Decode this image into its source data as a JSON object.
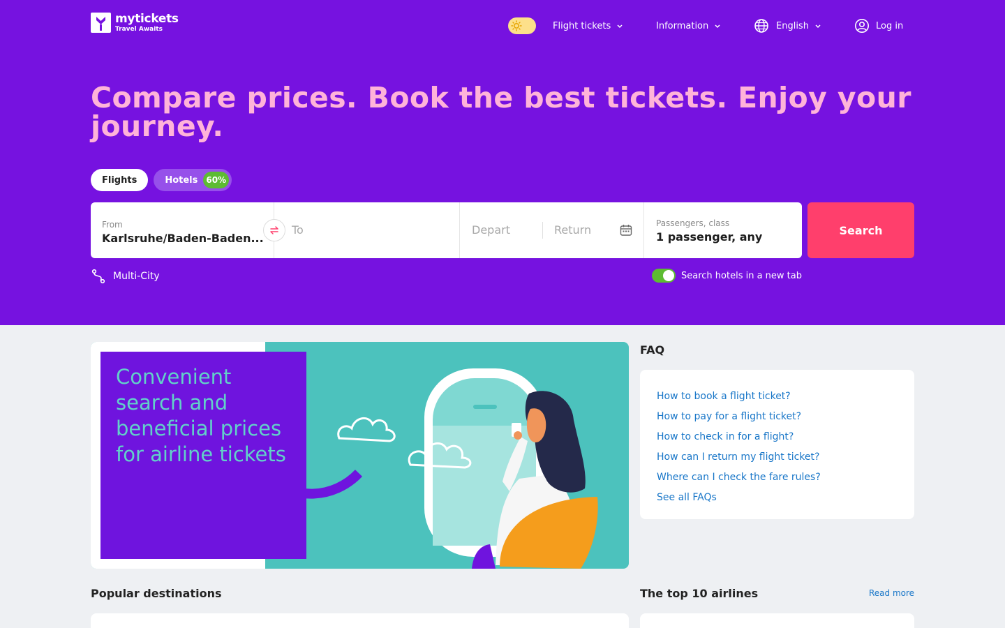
{
  "header": {
    "logo_name": "mytickets",
    "logo_tagline": "Travel Awaits",
    "nav": {
      "flight_tickets": "Flight tickets",
      "information": "Information",
      "language": "English",
      "login": "Log in"
    }
  },
  "hero": {
    "headline": "Compare prices. Book the best tickets. Enjoy your journey.",
    "tabs": {
      "flights": "Flights",
      "hotels": "Hotels",
      "hotels_badge": "60%"
    },
    "search": {
      "from_label": "From",
      "from_value": "Karlsruhe/Baden-Baden...",
      "to_placeholder": "To",
      "depart_placeholder": "Depart",
      "return_placeholder": "Return",
      "passengers_label": "Passengers, class",
      "passengers_value": "1 passenger, any",
      "button": "Search"
    },
    "multi_city": "Multi-City",
    "hotels_new_tab": "Search hotels in a new tab",
    "hotels_new_tab_enabled": true
  },
  "promo": {
    "text": "Convenient search and beneficial prices for airline tickets"
  },
  "faq": {
    "title": "FAQ",
    "links": [
      "How to book a flight ticket?",
      "How to pay for a flight ticket?",
      "How to check in for a flight?",
      "How can I return my flight ticket?",
      "Where can I check the fare rules?",
      "See all FAQs"
    ]
  },
  "sections": {
    "popular_destinations": "Popular destinations",
    "top_airlines": "The top 10 airlines",
    "read_more": "Read more"
  },
  "colors": {
    "hero_bg": "#7612e0",
    "headline": "#ffb3d9",
    "search_button": "#ff3f6c",
    "badge": "#5dbc32",
    "link": "#1876c8",
    "promo_teal": "#4cc2bd"
  }
}
